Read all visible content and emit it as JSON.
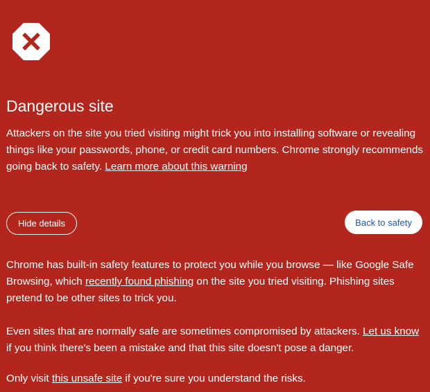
{
  "colors": {
    "background": "#b3261e",
    "text": "#ffffff",
    "primary_button_text": "#1a56c4"
  },
  "icon": {
    "name": "danger-octagon-icon"
  },
  "title": "Dangerous site",
  "intro": {
    "text": "Attackers on the site you tried visiting might trick you into installing software or revealing things like your passwords, phone, or credit card numbers. Chrome strongly recommends going back to safety.",
    "learn_more_link": "Learn more about this warning"
  },
  "buttons": {
    "hide_details": "Hide details",
    "back_to_safety": "Back to safety"
  },
  "details": {
    "p1_before": "Chrome has built-in safety features to protect you while you browse — like Google Safe Browsing, which",
    "p1_link": "recently found phishing",
    "p1_after": "on the site you tried visiting. Phishing sites pretend to be other sites to trick you.",
    "p2_before": "Even sites that are normally safe are sometimes compromised by attackers.",
    "p2_link": "Let us know",
    "p2_after": "if you think there's been a mistake and that this site doesn't pose a danger.",
    "p3_before": "Only visit",
    "p3_link": "this unsafe site",
    "p3_after": "if you're sure you understand the risks."
  }
}
